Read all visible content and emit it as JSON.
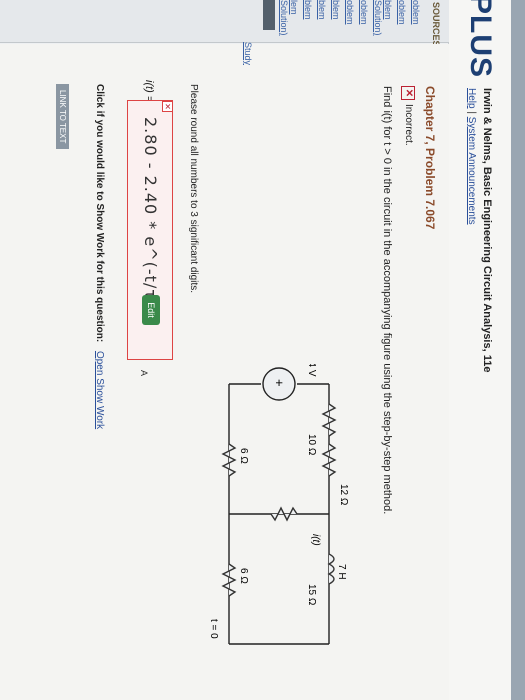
{
  "header": {
    "logo": "PLUS",
    "book_title": "Irwin & Nelms, Basic Engineering Circuit Analysis, 11e",
    "help": "Help",
    "separator": "|",
    "announcements": "System Announcements"
  },
  "sidebar": {
    "title": "SOURCES",
    "items": [
      "oblem",
      "oblem",
      "blem",
      "Solution)",
      "oblem",
      "oblem",
      "blem",
      "blem",
      "blem",
      "lem",
      "Solution)"
    ],
    "study": "Study"
  },
  "question": {
    "chapter": "Chapter 7, Problem 7.067",
    "status": "Incorrect.",
    "status_icon": "x-mark-icon",
    "prompt": "Find i(t) for t > 0 in the circuit in the accompanying figure using the step-by-step method.",
    "round_note": "Please round all numbers to 3 significant digits."
  },
  "answer": {
    "label": "i(t) =",
    "value": "2.80 - 2.40 * e^(-t/τ)",
    "edit": "Edit",
    "tag": "A"
  },
  "circuit": {
    "r_top": "12 Ω",
    "r_left_upper": "10 Ω",
    "r_right_upper": "15 Ω",
    "source": "84 V",
    "inductor": "7 H",
    "current": "i(t)",
    "r_left_lower": "6 Ω",
    "r_right_lower": "6 Ω",
    "switch": "t = 0"
  },
  "footer": {
    "show_work_prompt": "Click if you would like to Show Work for this question:",
    "show_work_link": "Open Show Work",
    "go_test": "LINK TO TEXT"
  },
  "colors": {
    "brand": "#1d3f73",
    "incorrect": "#b23333",
    "edit_button": "#3a8a4a",
    "link": "#2a4f9a"
  }
}
